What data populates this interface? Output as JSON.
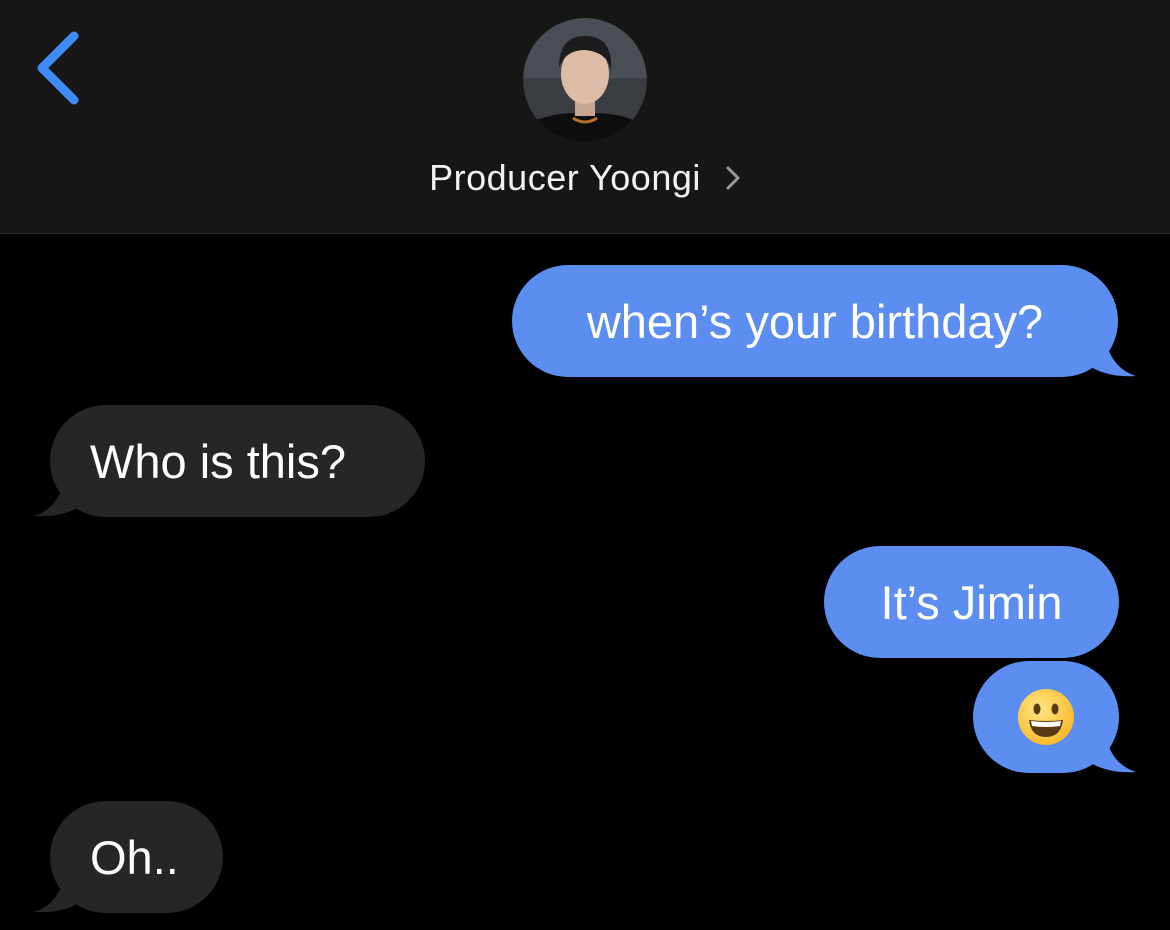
{
  "header": {
    "back_label": "Back",
    "contact_name": "Producer Yoongi",
    "avatar_icon": "contact-avatar-photo",
    "chevron_icon": "chevron-right-icon"
  },
  "colors": {
    "sent_bubble": "#5b8ef0",
    "received_bubble": "#262628",
    "header_bg": "#161616",
    "accent": "#3d8bf7"
  },
  "messages": [
    {
      "direction": "sent",
      "text": "when’s your birthday?"
    },
    {
      "direction": "received",
      "text": "Who is this?"
    },
    {
      "direction": "sent",
      "text": "It’s Jimin"
    },
    {
      "direction": "sent",
      "emoji": "grinning-face",
      "text": "😀"
    },
    {
      "direction": "received",
      "text": "Oh.."
    }
  ]
}
